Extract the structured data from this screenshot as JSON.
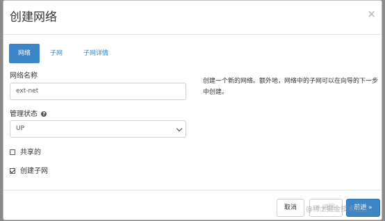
{
  "modal": {
    "title": "创建网络",
    "close_icon": "×",
    "tabs": [
      {
        "label": "网络",
        "active": true
      },
      {
        "label": "子网",
        "active": false
      },
      {
        "label": "子网详情",
        "active": false
      }
    ],
    "form": {
      "network_name_label": "网络名称",
      "network_name_value": "ext-net",
      "admin_state_label": "管理状态",
      "help_icon": "?",
      "admin_state_value": "UP",
      "shared_label": "共享的",
      "shared_checked": false,
      "create_subnet_label": "创建子网",
      "create_subnet_checked": true
    },
    "description": "创建一个新的网络。额外地，网络中的子网可以在向导的下一步中创建。",
    "footer": {
      "cancel_label": "取消",
      "back_label": "« 返回",
      "next_label": "前进 »"
    }
  },
  "watermark": "@稀土掘金技术社区",
  "colors": {
    "primary": "#3b86c8",
    "link": "#2f7fc1",
    "overlay": "#8a8a8a"
  }
}
